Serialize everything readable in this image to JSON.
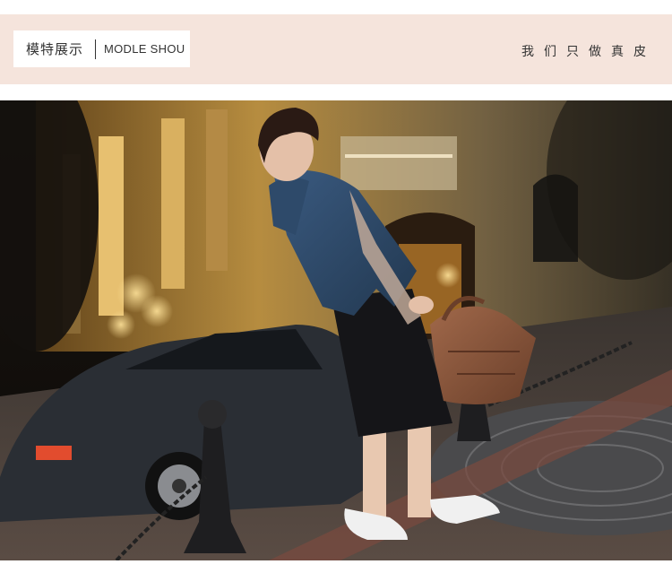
{
  "section_header": {
    "title_cn": "模特展示",
    "title_en": "MODLE SHOU",
    "slogan": "我们只做真皮"
  },
  "colors": {
    "header_band": "#f5e4dc",
    "title_box": "#ffffff",
    "text": "#333333"
  }
}
